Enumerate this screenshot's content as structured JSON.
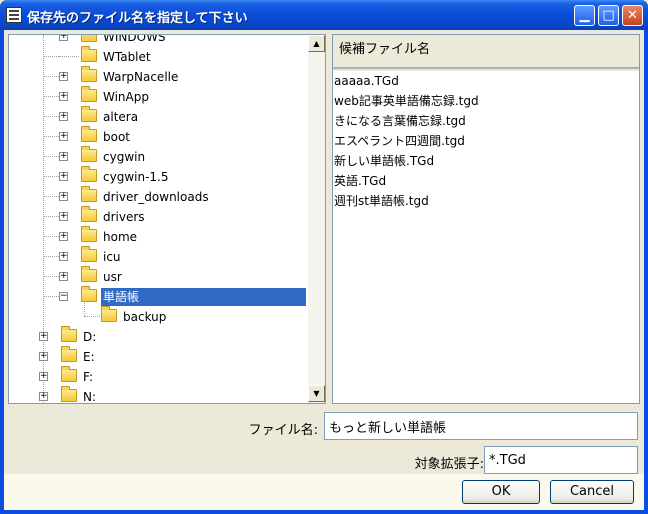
{
  "window": {
    "title": "保存先のファイル名を指定して下さい",
    "controls": {
      "minimize": "▁",
      "maximize": "□",
      "close": "✕"
    }
  },
  "tree": {
    "top_partial": "WINDOWS",
    "items": [
      {
        "label": "WTablet",
        "expandable": false
      },
      {
        "label": "WarpNacelle",
        "expandable": true
      },
      {
        "label": "WinApp",
        "expandable": true
      },
      {
        "label": "altera",
        "expandable": true
      },
      {
        "label": "boot",
        "expandable": true
      },
      {
        "label": "cygwin",
        "expandable": true
      },
      {
        "label": "cygwin-1.5",
        "expandable": true
      },
      {
        "label": "driver_downloads",
        "expandable": true
      },
      {
        "label": "drivers",
        "expandable": true
      },
      {
        "label": "home",
        "expandable": true
      },
      {
        "label": "icu",
        "expandable": true
      },
      {
        "label": "usr",
        "expandable": true
      },
      {
        "label": "単語帳",
        "expandable": true,
        "selected": true,
        "expanded": true
      }
    ],
    "subitems": [
      {
        "label": "backup"
      }
    ],
    "drives": [
      {
        "label": "D:"
      },
      {
        "label": "E:"
      },
      {
        "label": "F:"
      },
      {
        "label": "N:"
      }
    ]
  },
  "candidates": {
    "header": "候補ファイル名",
    "items": [
      "aaaaa.TGd",
      "web記事英単語備忘録.tgd",
      "きになる言葉備忘録.tgd",
      "エスペラント四週間.tgd",
      "新しい単語帳.TGd",
      "英語.TGd",
      "週刊st単語帳.tgd"
    ]
  },
  "form": {
    "filename_label": "ファイル名:",
    "filename_value": "もっと新しい単語帳",
    "ext_label": "対象拡張子:",
    "ext_value": "*.TGd"
  },
  "buttons": {
    "ok": "OK",
    "cancel": "Cancel"
  },
  "colors": {
    "title_bar": "#0a4cd8",
    "selection": "#316ac5",
    "dialog_bg": "#ece9d8"
  }
}
